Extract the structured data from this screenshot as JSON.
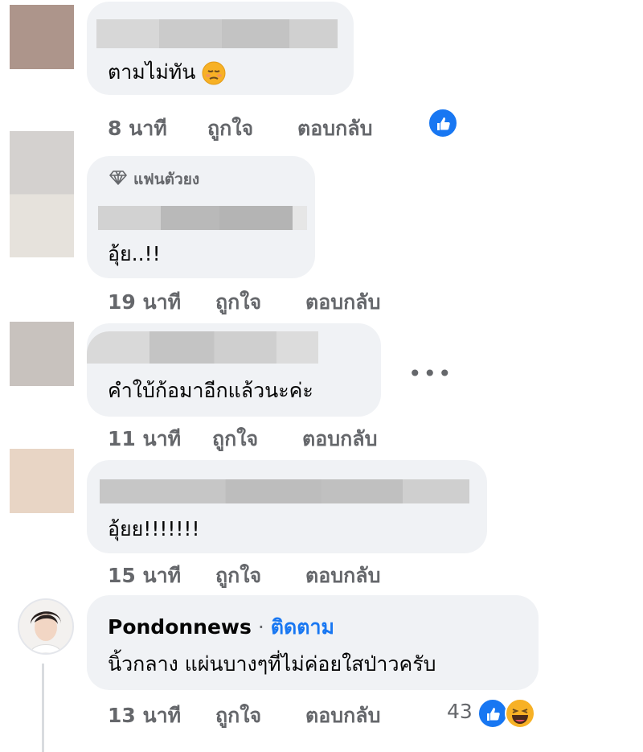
{
  "comments": [
    {
      "text": "ตามไม่ทัน",
      "time": "8 นาที",
      "like_label": "ถูกใจ",
      "reply_label": "ตอบกลับ",
      "avatar_color": "#ad958b"
    },
    {
      "badge": "แฟนตัวยง",
      "text": "อุ้ย..!!",
      "time": "19 นาที",
      "like_label": "ถูกใจ",
      "reply_label": "ตอบกลับ",
      "avatar_color": "#d4d1cf"
    },
    {
      "text": "คำใบ้ก้อมาอีกแล้วนะค่ะ",
      "time": "11 นาที",
      "like_label": "ถูกใจ",
      "reply_label": "ตอบกลับ",
      "avatar_color": "#c8c2be",
      "more_icon": "•••"
    },
    {
      "text": "อุ้ยย!!!!!!!",
      "time": "15 นาที",
      "like_label": "ถูกใจ",
      "reply_label": "ตอบกลับ",
      "avatar_color": "#e8d5c5"
    },
    {
      "author": "Pondonnews",
      "follow_label": "ติดตาม",
      "separator": "·",
      "text": "นิ้วกลาง แผ่นบางๆที่ไม่ค่อยใสป่าวครับ",
      "time": "13 นาที",
      "like_label": "ถูกใจ",
      "reply_label": "ตอบกลับ",
      "reaction_count": "43"
    }
  ],
  "colors": {
    "bubble": "#f0f2f5",
    "meta": "#65676b",
    "link": "#1877f2",
    "like": "#1877f2",
    "haha": "#f7b125"
  },
  "icons": [
    "sad-face-emoji",
    "diamond-icon",
    "like-reaction-icon",
    "haha-reaction-icon",
    "more-options-icon"
  ]
}
